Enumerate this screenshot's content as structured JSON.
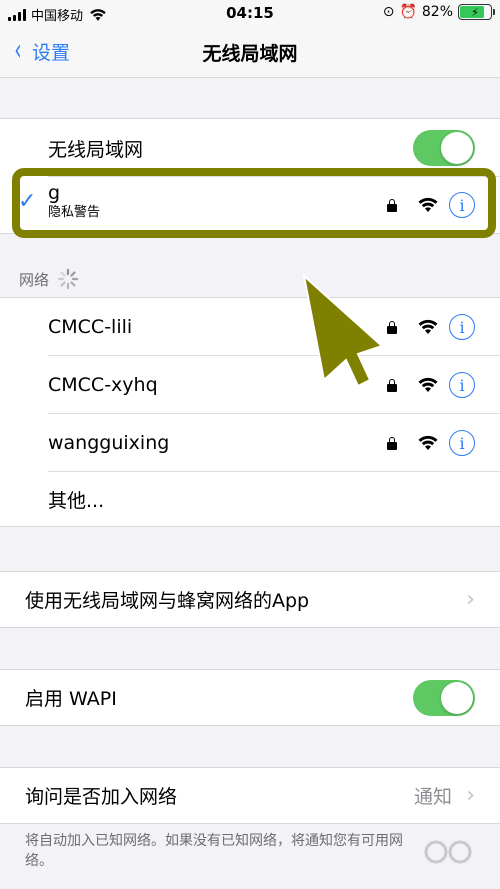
{
  "status_bar": {
    "carrier": "中国移动",
    "time": "04:15",
    "battery": "82%",
    "battery_level": 0.82
  },
  "nav": {
    "back_label": "设置",
    "title": "无线局域网"
  },
  "wifi_toggle": {
    "label": "无线局域网",
    "on": true
  },
  "connected_network": {
    "checkmark": "✓",
    "name": "g",
    "subtitle": "隐私警告"
  },
  "networks_section": {
    "header": "网络",
    "items": [
      {
        "name": "CMCC-lili"
      },
      {
        "name": "CMCC-xyhq"
      },
      {
        "name": "wangguixing"
      },
      {
        "name": "其他..."
      }
    ]
  },
  "apps_row": {
    "label": "使用无线局域网与蜂窝网络的App"
  },
  "wapi": {
    "label": "启用 WAPI",
    "on": true
  },
  "ask_join": {
    "label": "询问是否加入网络",
    "value": "通知",
    "footer": "将自动加入已知网络。如果没有已知网络，将通知您有可用网络。"
  },
  "icons": {
    "info": "i",
    "chevron": "›",
    "back": "‹"
  },
  "colors": {
    "accent": "#2d7cf6",
    "toggle_on": "#5ec862",
    "highlight": "#7f7f00",
    "background": "#f2f2f7"
  }
}
